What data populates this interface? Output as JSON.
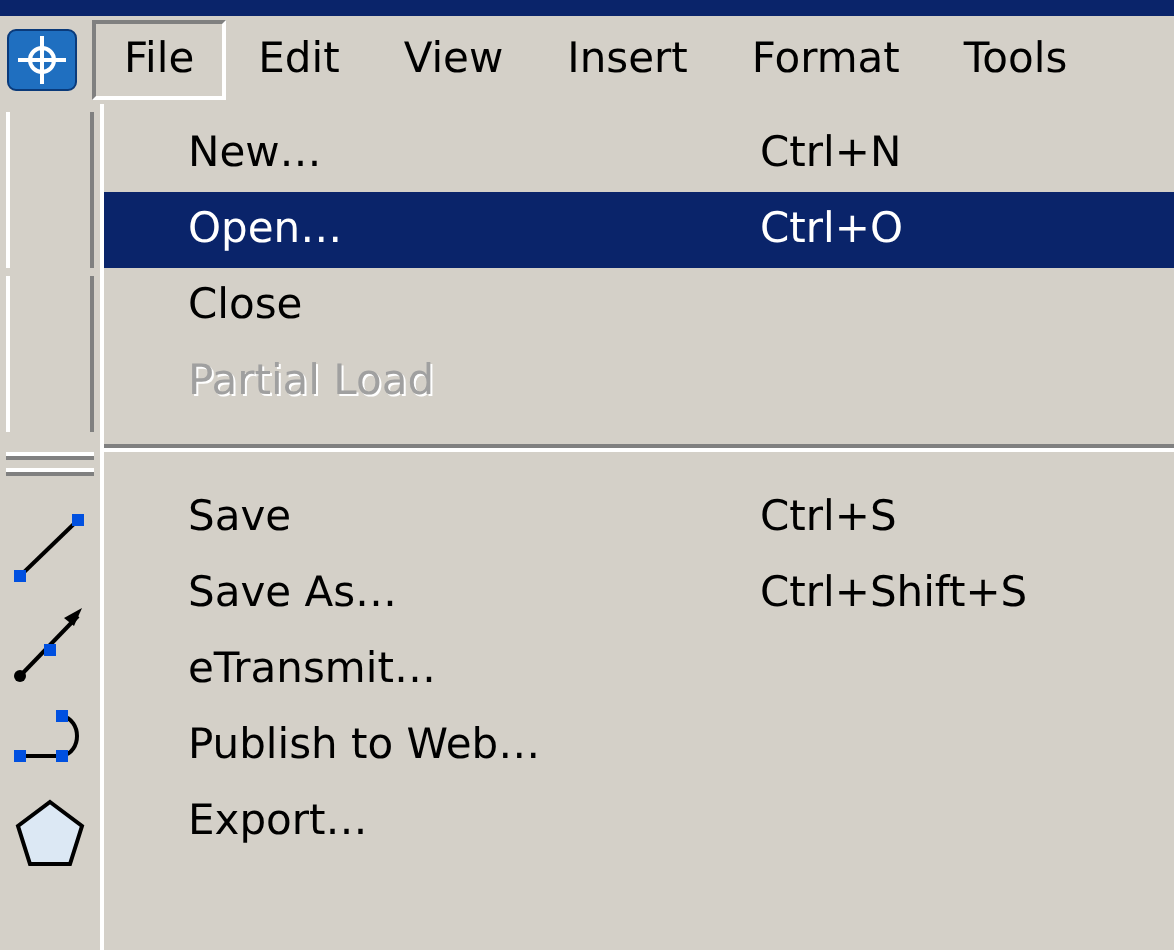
{
  "menu_bar": [
    {
      "label": "File",
      "selected": true
    },
    {
      "label": "Edit",
      "selected": false
    },
    {
      "label": "View",
      "selected": false
    },
    {
      "label": "Insert",
      "selected": false
    },
    {
      "label": "Format",
      "selected": false
    },
    {
      "label": "Tools",
      "selected": false
    }
  ],
  "file_menu": [
    {
      "kind": "item",
      "label": "New…",
      "shortcut": "Ctrl+N",
      "selected": false,
      "disabled": false
    },
    {
      "kind": "item",
      "label": "Open…",
      "shortcut": "Ctrl+O",
      "selected": true,
      "disabled": false
    },
    {
      "kind": "item",
      "label": "Close",
      "selected": false,
      "disabled": false
    },
    {
      "kind": "item",
      "label": "Partial Load",
      "selected": false,
      "disabled": true
    },
    {
      "kind": "separator"
    },
    {
      "kind": "item",
      "label": "Save",
      "shortcut": "Ctrl+S",
      "selected": false,
      "disabled": false
    },
    {
      "kind": "item",
      "label": "Save As…",
      "shortcut": "Ctrl+Shift+S",
      "selected": false,
      "disabled": false
    },
    {
      "kind": "item",
      "label": "eTransmit…",
      "selected": false,
      "disabled": false
    },
    {
      "kind": "item",
      "label": "Publish to Web…",
      "selected": false,
      "disabled": false
    },
    {
      "kind": "item",
      "label": "Export…",
      "selected": false,
      "disabled": false
    }
  ]
}
